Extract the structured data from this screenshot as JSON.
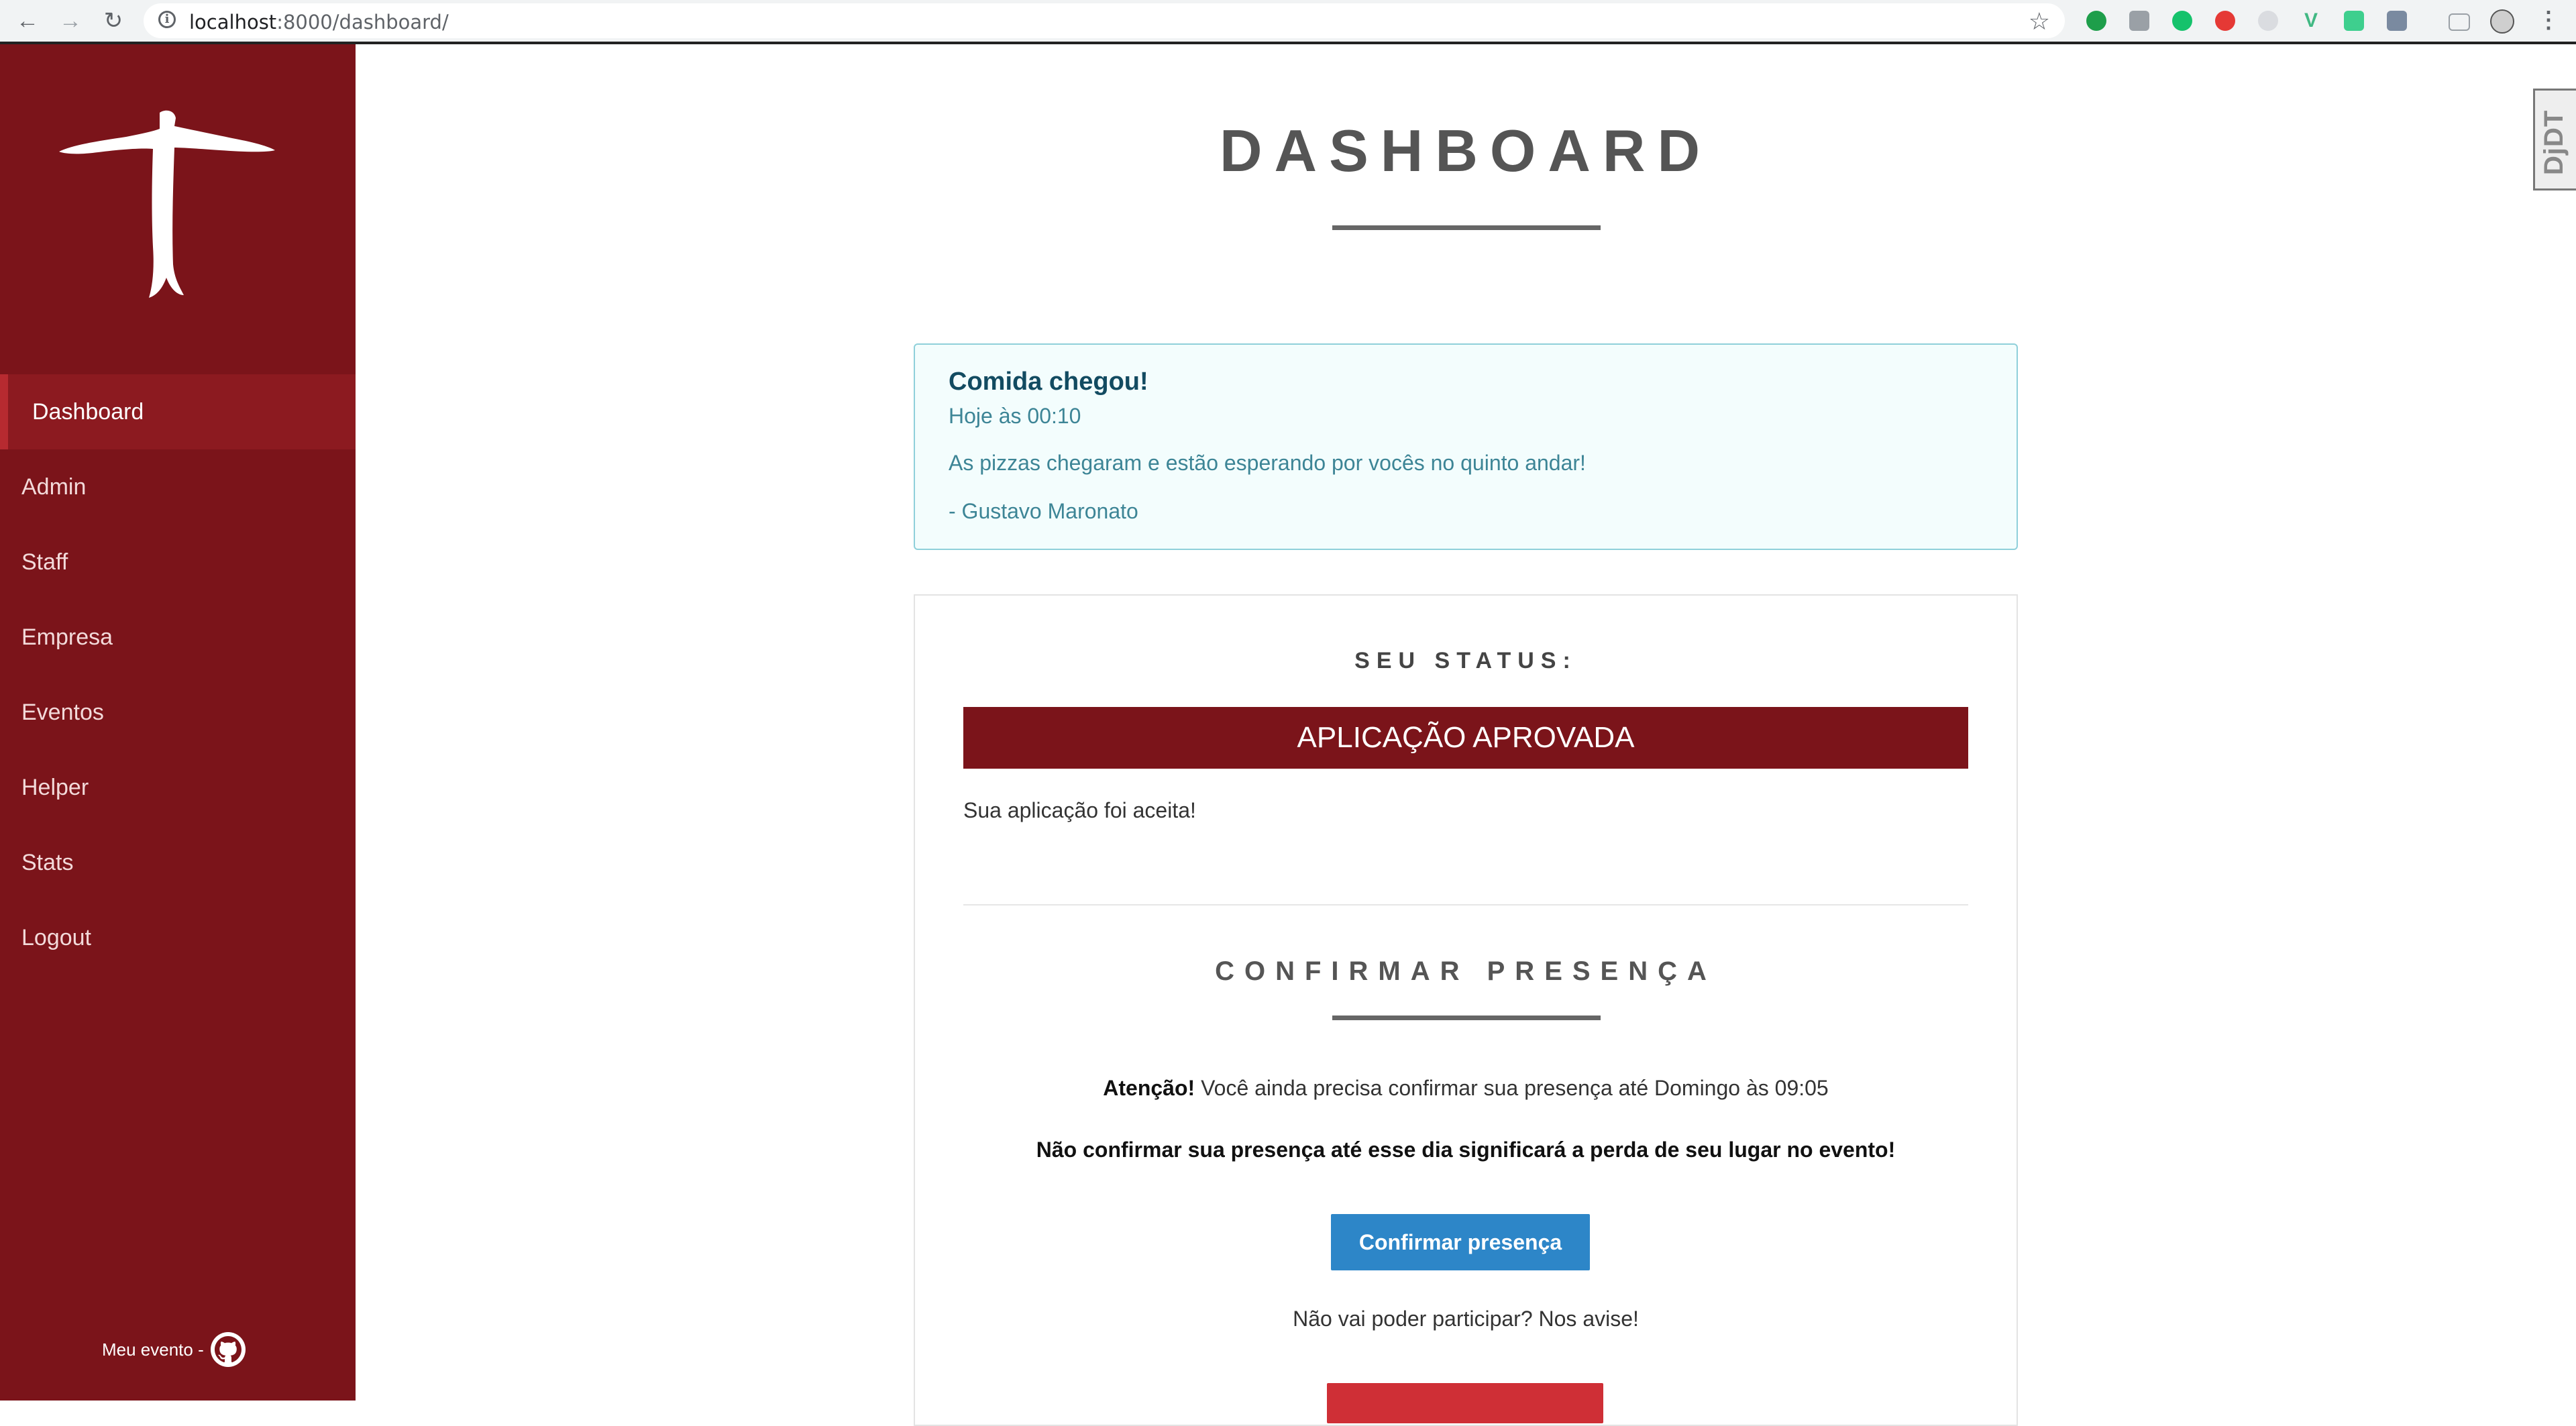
{
  "browser": {
    "url_host": "localhost",
    "url_path": ":8000/dashboard/"
  },
  "sidebar": {
    "items": [
      {
        "label": "Dashboard",
        "active": true
      },
      {
        "label": "Admin"
      },
      {
        "label": "Staff"
      },
      {
        "label": "Empresa"
      },
      {
        "label": "Eventos"
      },
      {
        "label": "Helper"
      },
      {
        "label": "Stats"
      },
      {
        "label": "Logout"
      }
    ],
    "footer_text": "Meu evento -"
  },
  "main": {
    "title": "DASHBOARD",
    "notice": {
      "title": "Comida chegou!",
      "time": "Hoje às 00:10",
      "body": "As pizzas chegaram e estão esperando por vocês no quinto andar!",
      "author": "- Gustavo Maronato"
    },
    "status": {
      "heading": "SEU STATUS:",
      "badge": "APLICAÇÃO APROVADA",
      "text": "Sua aplicação foi aceita!"
    },
    "confirm": {
      "heading": "CONFIRMAR PRESENÇA",
      "attention_label": "Atenção!",
      "attention_text": "Você ainda precisa confirmar sua presença até Domingo às 09:05",
      "warning": "Não confirmar sua presença até esse dia significará a perda de seu lugar no evento!",
      "button": "Confirmar presença",
      "cant_attend": "Não vai poder participar? Nos avise!"
    }
  },
  "debug_toolbar": {
    "label": "DjDT"
  },
  "colors": {
    "sidebar": "#7b141a",
    "sidebar_active": "#8c1a20",
    "notice_bg": "#f3fdfd",
    "notice_border": "#8fd0da",
    "primary_button": "#2d86c8",
    "danger_button": "#cf2f36"
  },
  "icons": [
    "back-arrow-icon",
    "forward-arrow-icon",
    "reload-icon",
    "info-icon",
    "bookmark-star-icon",
    "github-icon",
    "person-logo"
  ]
}
